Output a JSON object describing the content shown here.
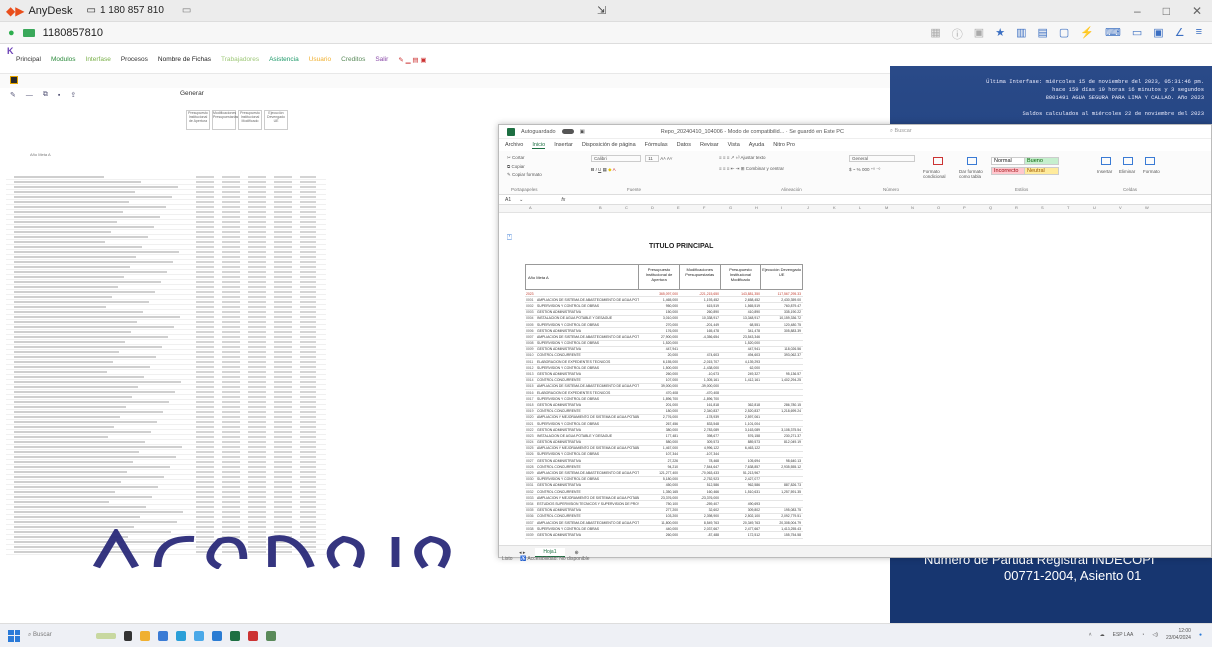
{
  "anydesk": {
    "app_name": "AnyDesk",
    "tab_label": "1 180 857 810",
    "remote_id": "1180857810"
  },
  "siaf": {
    "menu": [
      "Principal",
      "Modulos",
      "Interfase",
      "Procesos",
      "Nombre de Fichas",
      "Trabajadores",
      "Asistencia",
      "Usuario",
      "Creditos",
      "Salir"
    ],
    "generar_label": "Generar",
    "header_cols": [
      "Presupuesto Institucional de Apertura",
      "Modificaciones Presupuestarias",
      "Presupuesto Institucional Modificado",
      "Ejecución Devengado UE"
    ],
    "col_label": "Año Meta A"
  },
  "banner": {
    "line1": "Última Interfase: miércoles 15 de noviembre del 2023, 05:31:46 pm.",
    "line2": "hace 159 días 19 horas 16 minutos y 3 segundos",
    "line3": "8001491 AGUA SEGURA PARA LIMA Y CALLAO. Año 2023",
    "saldo": "Saldos calculados al miércoles 22 de noviembre del 2023",
    "partida": "Número de Partida Registral INDECOPI",
    "asiento": "00771-2004, Asiento 01"
  },
  "excel": {
    "autosave": "Autoguardado",
    "filename": "Repo_20240410_104006 - Modo de compatibilid... · Se guardó en Este PC",
    "search": "Buscar",
    "menu": [
      "Archivo",
      "Inicio",
      "Insertar",
      "Disposición de página",
      "Fórmulas",
      "Datos",
      "Revisar",
      "Vista",
      "Ayuda",
      "Nitro Pro"
    ],
    "active_menu": "Inicio",
    "ribbon": {
      "cortar": "Cortar",
      "copiar": "Copiar",
      "copiar_formato": "Copiar formato",
      "portapapeles": "Portapapeles",
      "font": "Calibri",
      "font_size": "11",
      "fuente": "Fuente",
      "ajustar_texto": "Ajustar texto",
      "combinar": "Combinar y centrar",
      "alineacion": "Alineación",
      "general": "General",
      "numero": "Número",
      "formato_cond": "Formato condicional",
      "dar_formato": "Dar formato como tabla",
      "estilo_normal": "Normal",
      "estilo_bueno": "Bueno",
      "estilo_incorrecto": "Incorrecto",
      "estilo_neutral": "Neutral",
      "estilos": "Estilos",
      "insertar": "Insertar",
      "eliminar": "Eliminar",
      "formato": "Formato",
      "celdas": "Celdas"
    },
    "name_box": "A1",
    "fx": "fx",
    "columns": [
      "A",
      "B",
      "C",
      "D",
      "E",
      "F",
      "G",
      "H",
      "I",
      "J",
      "K",
      "L",
      "M",
      "N",
      "O",
      "P",
      "Q",
      "R",
      "S",
      "T",
      "U",
      "V",
      "W"
    ],
    "sheet_title": "TITULO PRINCIPAL",
    "header": {
      "h0": "Año Meta A",
      "h1": "Presupuesto Institucional de Apertura",
      "h2": "Modificaciones Presupuestarias",
      "h3": "Presupuesto Institucional Modificado",
      "h4": "Ejecución Devengado UE"
    },
    "rows": [
      {
        "code": "2023",
        "desc": "",
        "v1": "365,097,000",
        "v2": "-221,215,650",
        "v3": "143,881,350",
        "v4": "117,567,295.33",
        "total": true
      },
      {
        "code": "0001",
        "desc": "AMPLIACION DE SISTEMA DE ABASTECIMIENTO DE AGUA POTABLE",
        "v1": "1,465,000",
        "v2": "1,193,452",
        "v3": "2,658,452",
        "v4": "2,430,359.00"
      },
      {
        "code": "0002",
        "desc": "SUPERVISION Y CONTROL DE OBRAS",
        "v1": "950,000",
        "v2": "615,519",
        "v3": "1,565,519",
        "v4": "760,879.47"
      },
      {
        "code": "0003",
        "desc": "GESTION ADMINISTRATIVA",
        "v1": "150,000",
        "v2": "260,890",
        "v3": "410,890",
        "v4": "335,190.22"
      },
      {
        "code": "0004",
        "desc": "INSTALACION DE AGUA POTABLE Y DESAGUE",
        "v1": "3,010,000",
        "v2": "10,338,917",
        "v3": "13,348,917",
        "v4": "10,159,336.72"
      },
      {
        "code": "0005",
        "desc": "SUPERVISION Y CONTROL DE OBRAS",
        "v1": "270,000",
        "v2": "-201,449",
        "v3": "68,551",
        "v4": "120,480.75"
      },
      {
        "code": "0006",
        "desc": "GESTION ADMINISTRATIVA",
        "v1": "176,000",
        "v2": "165,478",
        "v3": "341,478",
        "v4": "305,883.39"
      },
      {
        "code": "0007",
        "desc": "AMPLIACION DE SISTEMA DE ABASTECIMIENTO DE AGUA POTABLE",
        "v1": "27,900,000",
        "v2": "-4,356,654",
        "v3": "23,543,346",
        "v4": ""
      },
      {
        "code": "0008",
        "desc": "SUPERVISION Y CONTROL DE OBRAS",
        "v1": "1,520,000",
        "v2": "",
        "v3": "1,520,000",
        "v4": ""
      },
      {
        "code": "0009",
        "desc": "GESTION ADMINISTRATIVA",
        "v1": "447,941",
        "v2": "",
        "v3": "447,941",
        "v4": "118,026.56"
      },
      {
        "code": "0010",
        "desc": "CONTROL CONCURRENTE",
        "v1": "20,000",
        "v2": "474,603",
        "v3": "494,603",
        "v4": "393,062.37"
      },
      {
        "code": "0011",
        "desc": "ELABORACION DE EXPEDIENTES TECNICOS",
        "v1": "6,155,000",
        "v2": "-2,015,707",
        "v3": "4,139,293",
        "v4": ""
      },
      {
        "code": "0012",
        "desc": "SUPERVISION Y CONTROL DE OBRAS",
        "v1": "1,500,000",
        "v2": "-1,438,000",
        "v3": "62,000",
        "v4": ""
      },
      {
        "code": "0013",
        "desc": "GESTION ADMINISTRATIVA",
        "v1": "260,000",
        "v2": "-10,673",
        "v3": "249,327",
        "v4": "95,136.57"
      },
      {
        "code": "0014",
        "desc": "CONTROL CONCURRENTE",
        "v1": "107,000",
        "v2": "1,305,161",
        "v3": "1,412,161",
        "v4": "1,402,294.25"
      },
      {
        "code": "0015",
        "desc": "AMPLIACION DE SISTEMA DE ABASTECIMIENTO DE AGUA POTABLE",
        "v1": "39,000,000",
        "v2": "-39,000,000",
        "v3": "",
        "v4": ""
      },
      {
        "code": "0016",
        "desc": "ELABORACION DE EXPEDIENTES TECNICOS",
        "v1": "470,408",
        "v2": "-470,408",
        "v3": "",
        "v4": ""
      },
      {
        "code": "0017",
        "desc": "SUPERVISION Y CONTROL DE OBRAS",
        "v1": "1,896,700",
        "v2": "-1,896,700",
        "v3": "",
        "v4": ""
      },
      {
        "code": "0018",
        "desc": "GESTION ADMINISTRATIVA",
        "v1": "201,000",
        "v2": "161,818",
        "v3": "362,818",
        "v4": "286,780.15"
      },
      {
        "code": "0019",
        "desc": "CONTROL CONCURRENTE",
        "v1": "180,000",
        "v2": "2,340,837",
        "v3": "2,520,837",
        "v4": "1,218,699.24"
      },
      {
        "code": "0020",
        "desc": "AMPLIACION Y MEJORAMIENTO DE SISTEMA DE AGUA POTABLE Y ALCANTA",
        "v1": "2,776,000",
        "v2": "-178,939",
        "v3": "2,597,061",
        "v4": ""
      },
      {
        "code": "0021",
        "desc": "SUPERVISION Y CONTROL DE OBRAS",
        "v1": "267,456",
        "v2": "833,548",
        "v3": "1,101,004",
        "v4": ""
      },
      {
        "code": "0022",
        "desc": "GESTION ADMINISTRATIVA",
        "v1": "380,000",
        "v2": "2,783,089",
        "v3": "3,163,089",
        "v4": "3,108,375.54"
      },
      {
        "code": "0023",
        "desc": "INSTALACION DE AGUA POTABLE Y DESAGUE",
        "v1": "177,481",
        "v2": "398,677",
        "v3": "576,158",
        "v4": "230,271.37"
      },
      {
        "code": "0024",
        "desc": "GESTION ADMINISTRATIVA",
        "v1": "580,000",
        "v2": "309,573",
        "v3": "889,573",
        "v4": "812,049.19"
      },
      {
        "code": "0025",
        "desc": "AMPLIACION Y MEJORAMIENTO DE SISTEMA DE AGUA POTABLE Y ALCANTA",
        "v1": "1,467,000",
        "v2": "4,996,122",
        "v3": "6,463,122",
        "v4": ""
      },
      {
        "code": "0026",
        "desc": "SUPERVISION Y CONTROL DE OBRAS",
        "v1": "107,344",
        "v2": "-107,344",
        "v3": "",
        "v4": ""
      },
      {
        "code": "0027",
        "desc": "GESTION ADMINISTRATIVA",
        "v1": "27,226",
        "v2": "78,468",
        "v3": "105,694",
        "v4": "98,640.13"
      },
      {
        "code": "0028",
        "desc": "CONTROL CONCURRENTE",
        "v1": "94,210",
        "v2": "7,544,647",
        "v3": "7,638,857",
        "v4": "2,935,555.12"
      },
      {
        "code": "0029",
        "desc": "AMPLIACION DE SISTEMA DE ABASTECIMIENTO DE AGUA POTABLE Y ALCANTA",
        "v1": "121,277,400",
        "v2": "-70,063,433",
        "v3": "51,213,967",
        "v4": ""
      },
      {
        "code": "0030",
        "desc": "SUPERVISION Y CONTROL DE OBRAS",
        "v1": "5,180,000",
        "v2": "-2,752,923",
        "v3": "2,427,077",
        "v4": ""
      },
      {
        "code": "0031",
        "desc": "GESTION ADMINISTRATIVA",
        "v1": "450,000",
        "v2": "512,586",
        "v3": "962,586",
        "v4": "887,826.73"
      },
      {
        "code": "0032",
        "desc": "CONTROL CONCURRENTE",
        "v1": "1,350,165",
        "v2": "160,466",
        "v3": "1,510,631",
        "v4": "1,257,591.35"
      },
      {
        "code": "0033",
        "desc": "AMPLIACION Y MEJORAMIENTO DE SISTEMA DE AGUA POTABLE Y ALCANTA",
        "v1": "23,376,000",
        "v2": "-23,376,000",
        "v3": "",
        "v4": ""
      },
      {
        "code": "0034",
        "desc": "ESTUDIOS SUPERVISION TECNICOS Y SUPERVISION DE PROYECTOS",
        "v1": "750,100",
        "v2": "-259,407",
        "v3": "490,693",
        "v4": ""
      },
      {
        "code": "0035",
        "desc": "GESTION ADMINISTRATIVA",
        "v1": "277,200",
        "v2": "32,602",
        "v3": "309,802",
        "v4": "195,083.75"
      },
      {
        "code": "0036",
        "desc": "CONTROL CONCURRENTE",
        "v1": "103,200",
        "v2": "2,398,900",
        "v3": "2,502,100",
        "v4": "2,092,779.51"
      },
      {
        "code": "0037",
        "desc": "AMPLIACION DE SISTEMA DE ABASTECIMIENTO DE AGUA POTABLE",
        "v1": "11,800,000",
        "v2": "8,549,763",
        "v3": "20,349,763",
        "v4": "20,308,004.79"
      },
      {
        "code": "0038",
        "desc": "SUPERVISION Y CONTROL DE OBRAS",
        "v1": "440,000",
        "v2": "2,037,667",
        "v3": "2,477,667",
        "v4": "1,413,255.43"
      },
      {
        "code": "0039",
        "desc": "GESTION ADMINISTRATIVA",
        "v1": "260,000",
        "v2": "-87,488",
        "v3": "172,512",
        "v4": "155,754.58"
      }
    ],
    "sheet_tab": "Hoja1",
    "accessibility": "Accesibilidad: No disponible",
    "ready": "Listo"
  },
  "taskbar": {
    "search": "Buscar",
    "time": "12:00",
    "date": "23/04/2024",
    "lang": "ESP LAA"
  }
}
